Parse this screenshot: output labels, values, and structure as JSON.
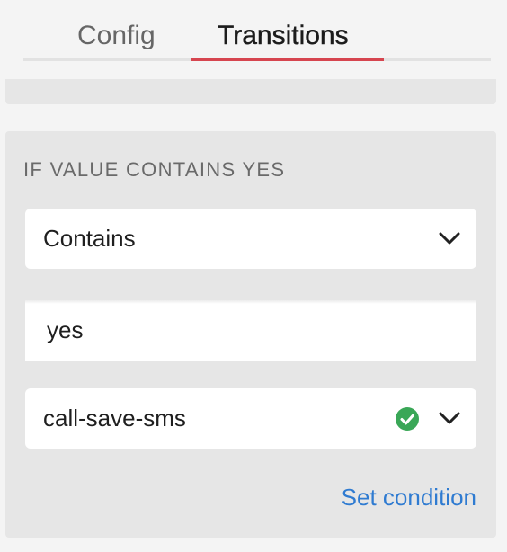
{
  "tabs": [
    {
      "label": "Config",
      "active": false
    },
    {
      "label": "Transitions",
      "active": true
    }
  ],
  "colors": {
    "active_tab_underline": "#d6454f",
    "link": "#2f7bd1",
    "valid_check": "#3aa757",
    "panel_bg": "#e6e6e6"
  },
  "condition": {
    "heading": "IF VALUE CONTAINS YES",
    "operator": {
      "selected": "Contains",
      "icon": "chevron-down-icon"
    },
    "value": "yes",
    "target": {
      "selected": "call-save-sms",
      "status_icon": "check-circle-icon",
      "icon": "chevron-down-icon"
    },
    "set_condition_label": "Set condition"
  }
}
